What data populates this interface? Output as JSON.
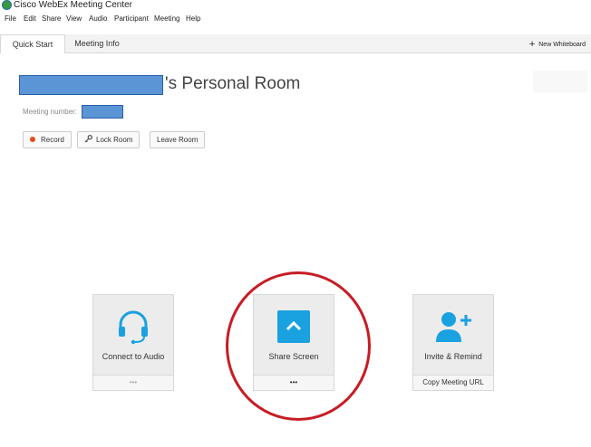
{
  "window": {
    "title": "Cisco WebEx Meeting Center"
  },
  "menu": [
    "File",
    "Edit",
    "Share",
    "View",
    "Audio",
    "Participant",
    "Meeting",
    "Help"
  ],
  "tabs": [
    {
      "label": "Quick Start",
      "active": true
    },
    {
      "label": "Meeting Info",
      "active": false
    }
  ],
  "new_whiteboard": "New Whiteboard",
  "room": {
    "title_suffix": "'s Personal Room",
    "meeting_number_label": "Meeting number:"
  },
  "actions": {
    "record": "Record",
    "lock": "Lock Room",
    "leave": "Leave Room"
  },
  "tiles": {
    "audio": {
      "label": "Connect to Audio",
      "footer": "•••"
    },
    "share": {
      "label": "Share Screen",
      "footer": "•••"
    },
    "invite": {
      "label": "Invite & Remind",
      "footer": "Copy Meeting URL"
    }
  },
  "colors": {
    "accent": "#1aa1e0",
    "record": "#e64a19",
    "annotation": "#c71c24",
    "redaction": "#5b95d6"
  }
}
